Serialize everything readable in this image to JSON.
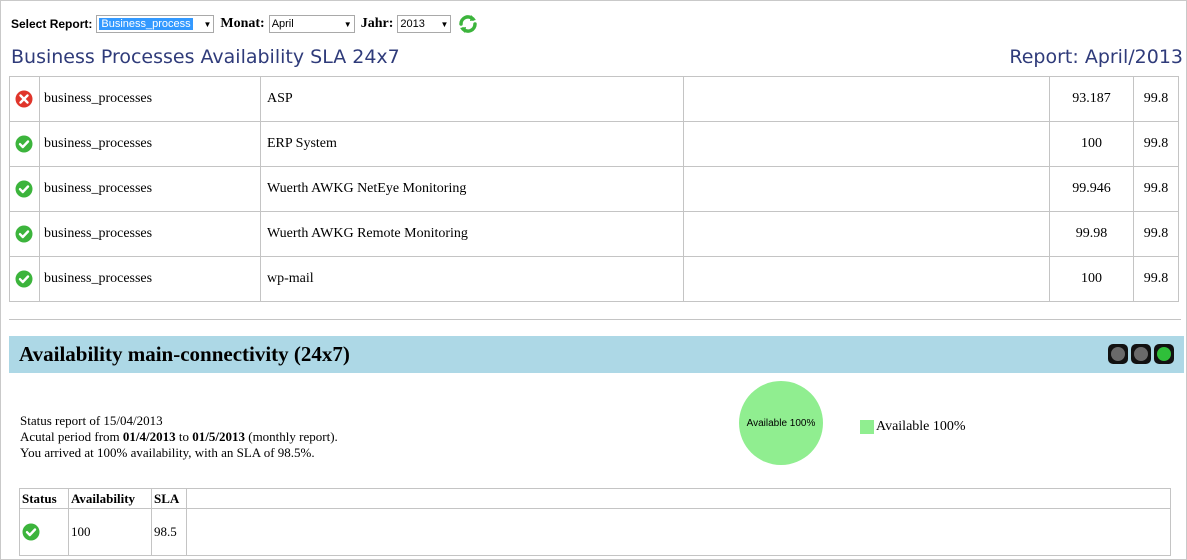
{
  "toolbar": {
    "report_label": "Select Report:",
    "report_value": "Business_process",
    "month_label": "Monat:",
    "month_value": "April",
    "year_label": "Jahr:",
    "year_value": "2013",
    "refresh_icon": "refresh-icon"
  },
  "header": {
    "title": "Business Processes Availability SLA 24x7",
    "report": "Report: April/2013"
  },
  "rows": [
    {
      "status": "error-icon",
      "group": "business_processes",
      "name": "ASP",
      "availability": "93.187",
      "sla": "99.8"
    },
    {
      "status": "ok-icon",
      "group": "business_processes",
      "name": "ERP System",
      "availability": "100",
      "sla": "99.8"
    },
    {
      "status": "ok-icon",
      "group": "business_processes",
      "name": "Wuerth AWKG NetEye Monitoring",
      "availability": "99.946",
      "sla": "99.8"
    },
    {
      "status": "ok-icon",
      "group": "business_processes",
      "name": "Wuerth AWKG Remote Monitoring",
      "availability": "99.98",
      "sla": "99.8"
    },
    {
      "status": "ok-icon",
      "group": "business_processes",
      "name": "wp-mail",
      "availability": "100",
      "sla": "99.8"
    }
  ],
  "availability": {
    "title": "Availability main-connectivity (24x7)",
    "status_line": "Status report of 15/04/2013",
    "period_prefix": "Acutal period from ",
    "period_from": "01/4/2013",
    "period_to_word": " to ",
    "period_to": "01/5/2013",
    "period_suffix": " (monthly report).",
    "summary_line": "You arrived at 100% availability, with an SLA of 98.5%.",
    "pie_label": "Available 100%",
    "legend_label": "Available 100%",
    "colors": {
      "available": "#90ee90",
      "bar": "#add8e6"
    },
    "table": {
      "headers": [
        "Status",
        "Availability",
        "SLA"
      ],
      "row": {
        "status": "ok-icon",
        "availability": "100",
        "sla": "98.5"
      }
    }
  }
}
